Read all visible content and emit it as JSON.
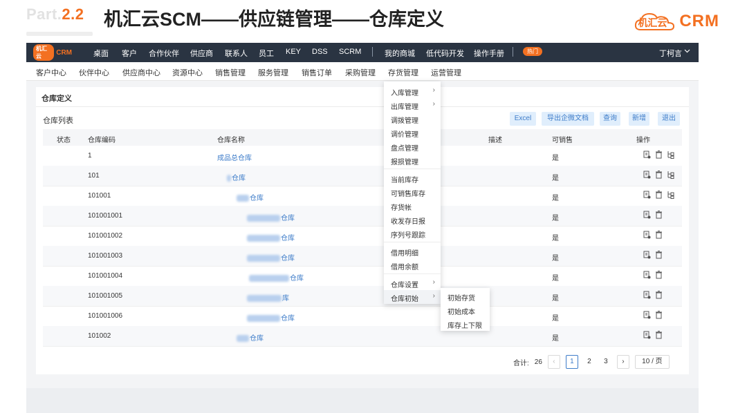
{
  "slide": {
    "part_prefix": "Part.",
    "part_number": "2.2",
    "title": "机汇云SCM——供应链管理——仓库定义",
    "logo_cn": "机汇云",
    "logo_en": "CRM",
    "accent_color": "#f37021"
  },
  "topnav": {
    "logo_badge": "机汇云",
    "logo_text": "CRM",
    "items": [
      "桌面",
      "客户",
      "合作伙伴",
      "供应商",
      "联系人",
      "员工",
      "KEY",
      "DSS",
      "SCRM",
      "我的商城",
      "低代码开发",
      "操作手册"
    ],
    "hot_badge": "热门",
    "user": "丁柯言",
    "background": "#2a3442"
  },
  "subnav": {
    "items": [
      "客户中心",
      "伙伴中心",
      "供应商中心",
      "资源中心",
      "销售管理",
      "服务管理",
      "销售订单",
      "采购管理",
      "存货管理",
      "运营管理"
    ]
  },
  "panel": {
    "title": "仓库定义",
    "list_title": "仓库列表",
    "buttons": [
      "Excel",
      "导出企微文档",
      "查询",
      "新增",
      "退出"
    ]
  },
  "table": {
    "headers": [
      "状态",
      "仓库编码",
      "仓库名称",
      "描述",
      "可销售",
      "操作"
    ],
    "rows": [
      {
        "code": "1",
        "name": "成品总仓库",
        "saleable": "是"
      },
      {
        "code": "101",
        "name": "仓库",
        "saleable": "是"
      },
      {
        "code": "101001",
        "name": "仓库",
        "saleable": "是"
      },
      {
        "code": "101001001",
        "name": "仓库",
        "saleable": "是"
      },
      {
        "code": "101001002",
        "name": "仓库",
        "saleable": "是"
      },
      {
        "code": "101001003",
        "name": "仓库",
        "saleable": "是"
      },
      {
        "code": "101001004",
        "name": "仓库",
        "saleable": "是"
      },
      {
        "code": "101001005",
        "name": "库",
        "saleable": "是"
      },
      {
        "code": "101001006",
        "name": "仓库",
        "saleable": "是"
      },
      {
        "code": "101002",
        "name": "仓库",
        "saleable": "是"
      }
    ]
  },
  "pagination": {
    "total_label": "合计:",
    "total": "26",
    "pages": [
      "1",
      "2",
      "3"
    ],
    "current": "1",
    "page_size": "10 / 页",
    "prev": "‹",
    "next": "›"
  },
  "dropdown": {
    "items": [
      "入库管理",
      "出库管理",
      "调拨管理",
      "调价管理",
      "盘点管理",
      "报损管理",
      "当前库存",
      "可销售库存",
      "存货帐",
      "收发存日报",
      "序列号跟踪",
      "借用明细",
      "借用余额",
      "仓库设置",
      "仓库初始"
    ],
    "submenu_arrow": "›"
  },
  "submenu": {
    "items": [
      "初始存货",
      "初始成本",
      "库存上下限"
    ]
  }
}
